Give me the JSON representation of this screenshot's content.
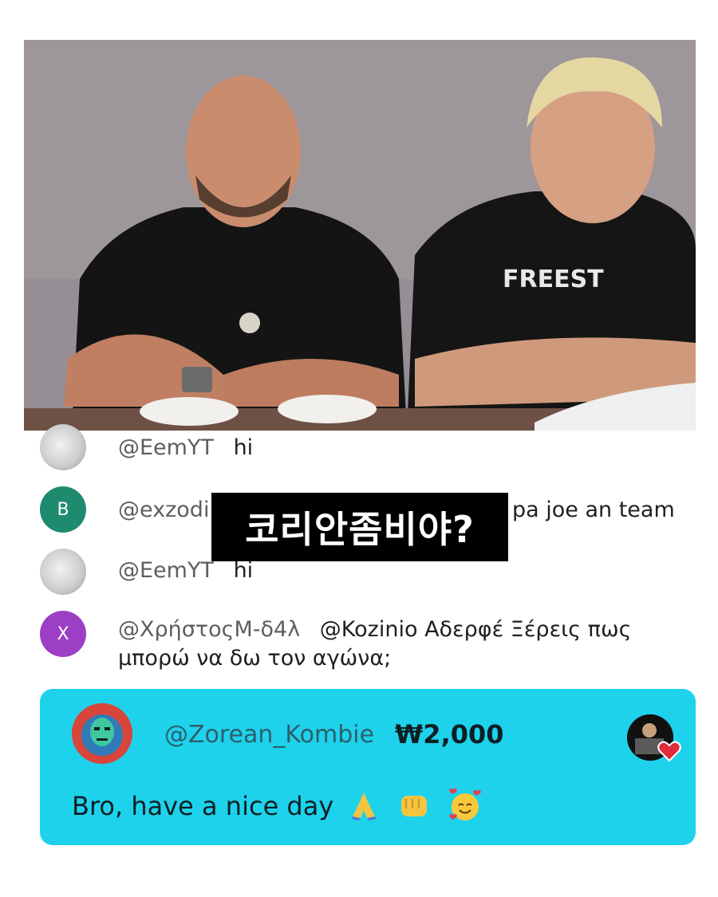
{
  "video": {
    "shirt_text": "FREEST"
  },
  "overlay_caption": "코리안좀비야?",
  "chat": {
    "messages": [
      {
        "avatar_type": "photo",
        "author": "@EemYT",
        "text": "hi"
      },
      {
        "avatar_type": "letter",
        "avatar_letter": "B",
        "avatar_color": "#1e8a6e",
        "author": "@exzodi",
        "text": "pa joe an team"
      },
      {
        "avatar_type": "photo",
        "author": "@EemYT",
        "text": "hi"
      },
      {
        "avatar_type": "letter",
        "avatar_letter": "X",
        "avatar_color": "#9c3fc4",
        "author": "@ΧρήστοςΜ-δ4λ",
        "text": "@Kozinio Αδερφέ Ξέρεις πως μπορώ να δω τον αγώνα;"
      }
    ]
  },
  "superchat": {
    "author": "@Zorean_Kombie",
    "amount": "₩2,000",
    "message": "Bro, have a nice day",
    "emojis": [
      "folded-hands",
      "oncoming-fist",
      "smiling-face-with-hearts"
    ],
    "background_color": "#1ed2ec",
    "channel_avatar_icon": "heart-badge-icon"
  }
}
